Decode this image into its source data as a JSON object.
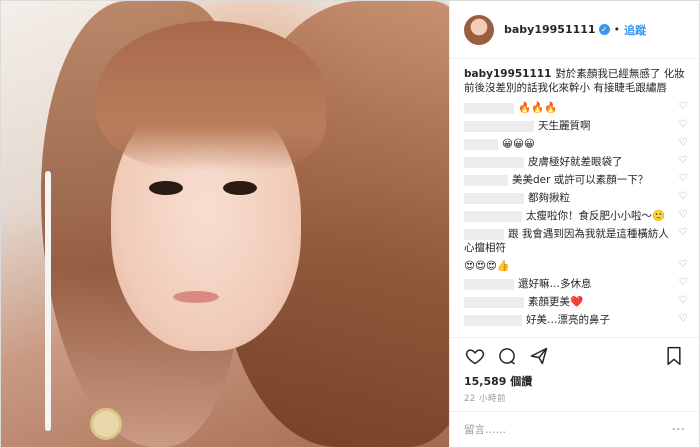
{
  "post": {
    "username": "baby19951111",
    "follow_label": "追蹤",
    "caption": "對於素顏我已經無感了 化妝前後沒差別的話我化來幹小 有接睫毛跟繡唇",
    "likes": "15,589 個讚",
    "time": "22 小時前"
  },
  "comments": [
    {
      "text": "🔥🔥🔥",
      "blur_w": 50,
      "liked": false
    },
    {
      "text": "天生麗質啊",
      "blur_w": 70,
      "liked": false
    },
    {
      "text": "😀😀😀",
      "blur_w": 34,
      "liked": false
    },
    {
      "text": "皮膚極好就差眼袋了",
      "blur_w": 60,
      "liked": false
    },
    {
      "text": "美美der 或許可以素顏一下？",
      "blur_w": 44,
      "liked": false
    },
    {
      "text": "都夠揪粒",
      "blur_w": 60,
      "liked": false
    },
    {
      "text": "太瘦啦你！食反肥小小啦～🙂",
      "blur_w": 58,
      "liked": false
    },
    {
      "text": "跟 我會遇到因為我就是這種橫紡人 心擅相符",
      "blur_w": 40,
      "liked": false
    },
    {
      "text": "😍😍😍👍",
      "blur_w": 0,
      "liked": false
    },
    {
      "text": "還好嘛…多休息",
      "blur_w": 50,
      "liked": false
    },
    {
      "text": "素顏更美❤️",
      "blur_w": 60,
      "liked": false
    },
    {
      "text": "好美…漂亮的鼻子",
      "blur_w": 58,
      "liked": false
    }
  ],
  "icons": {
    "heart": "heart-icon",
    "comment": "comment-icon",
    "share": "share-icon",
    "bookmark": "bookmark-icon"
  },
  "add_comment": {
    "placeholder": "留言……",
    "more": "···"
  },
  "colors": {
    "accent": "#3897f0",
    "like_red": "#ed4956",
    "muted": "#999999"
  }
}
